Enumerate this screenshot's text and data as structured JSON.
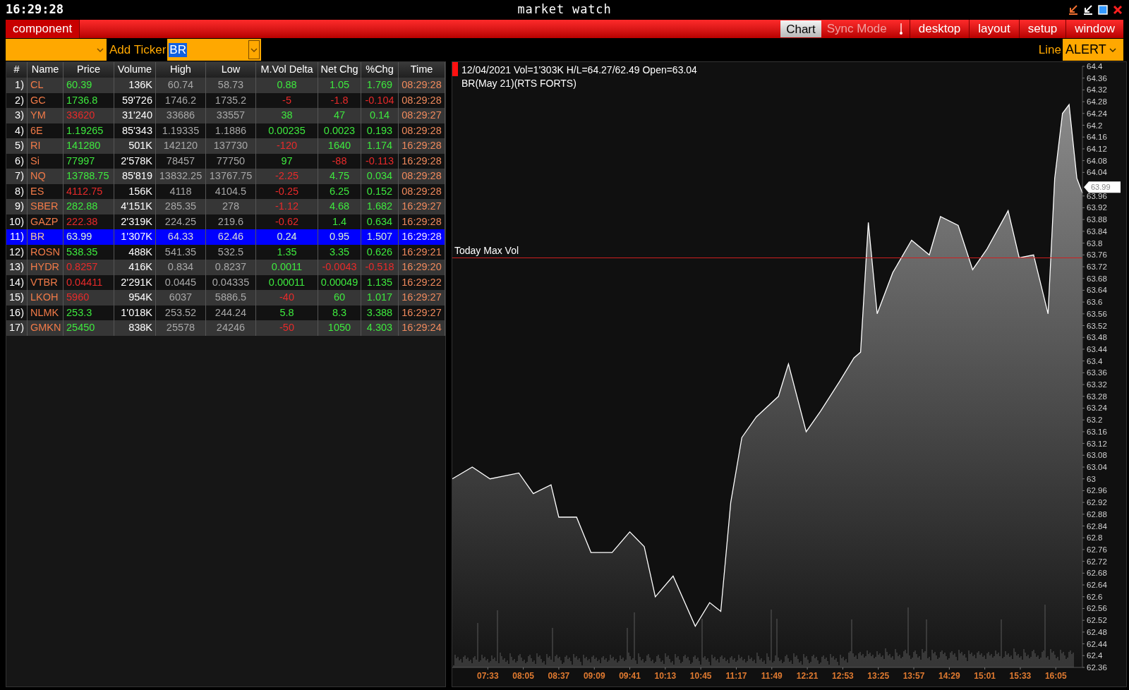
{
  "window": {
    "clock": "16:29:28",
    "title": "market watch"
  },
  "menu_bar": {
    "component": "component",
    "mode_buttons": [
      {
        "label": "Chart",
        "selected": true
      },
      {
        "label": "Sync Mode",
        "selected": false
      }
    ],
    "menus": [
      "desktop",
      "layout",
      "setup",
      "window"
    ]
  },
  "toolbar": {
    "add_ticker_label": "Add Ticker",
    "ticker_value": "BR",
    "line_label": "Line",
    "line_value": "ALERT"
  },
  "table": {
    "columns": [
      "#",
      "Name",
      "Price",
      "Volume",
      "High",
      "Low",
      "M.Vol Delta",
      "Net Chg",
      "%Chg",
      "Time"
    ],
    "rows": [
      {
        "num": "1)",
        "name": "CL",
        "price": {
          "text": "60.39",
          "up": true
        },
        "volume": "136K",
        "high": "60.74",
        "low": "58.73",
        "mvol_delta": {
          "text": "0.88",
          "up": true
        },
        "net_chg": {
          "text": "1.05",
          "up": true
        },
        "pct_chg": {
          "text": "1.769",
          "up": true
        },
        "time": "08:29:28",
        "selected": false
      },
      {
        "num": "2)",
        "name": "GC",
        "price": {
          "text": "1736.8",
          "up": true
        },
        "volume": "59'726",
        "high": "1746.2",
        "low": "1735.2",
        "mvol_delta": {
          "text": "-5",
          "up": false
        },
        "net_chg": {
          "text": "-1.8",
          "up": false
        },
        "pct_chg": {
          "text": "-0.104",
          "up": false
        },
        "time": "08:29:28",
        "selected": false
      },
      {
        "num": "3)",
        "name": "YM",
        "price": {
          "text": "33620",
          "up": false
        },
        "volume": "31'240",
        "high": "33686",
        "low": "33557",
        "mvol_delta": {
          "text": "38",
          "up": true
        },
        "net_chg": {
          "text": "47",
          "up": true
        },
        "pct_chg": {
          "text": "0.14",
          "up": true
        },
        "time": "08:29:27",
        "selected": false
      },
      {
        "num": "4)",
        "name": "6E",
        "price": {
          "text": "1.19265",
          "up": true
        },
        "volume": "85'343",
        "high": "1.19335",
        "low": "1.1886",
        "mvol_delta": {
          "text": "0.00235",
          "up": true
        },
        "net_chg": {
          "text": "0.0023",
          "up": true
        },
        "pct_chg": {
          "text": "0.193",
          "up": true
        },
        "time": "08:29:28",
        "selected": false
      },
      {
        "num": "5)",
        "name": "RI",
        "price": {
          "text": "141280",
          "up": true
        },
        "volume": "501K",
        "high": "142120",
        "low": "137730",
        "mvol_delta": {
          "text": "-120",
          "up": false
        },
        "net_chg": {
          "text": "1640",
          "up": true
        },
        "pct_chg": {
          "text": "1.174",
          "up": true
        },
        "time": "16:29:28",
        "selected": false
      },
      {
        "num": "6)",
        "name": "Si",
        "price": {
          "text": "77997",
          "up": true
        },
        "volume": "2'578K",
        "high": "78457",
        "low": "77750",
        "mvol_delta": {
          "text": "97",
          "up": true
        },
        "net_chg": {
          "text": "-88",
          "up": false
        },
        "pct_chg": {
          "text": "-0.113",
          "up": false
        },
        "time": "16:29:28",
        "selected": false
      },
      {
        "num": "7)",
        "name": "NQ",
        "price": {
          "text": "13788.75",
          "up": true
        },
        "volume": "85'819",
        "high": "13832.25",
        "low": "13767.75",
        "mvol_delta": {
          "text": "-2.25",
          "up": false
        },
        "net_chg": {
          "text": "4.75",
          "up": true
        },
        "pct_chg": {
          "text": "0.034",
          "up": true
        },
        "time": "08:29:28",
        "selected": false
      },
      {
        "num": "8)",
        "name": "ES",
        "price": {
          "text": "4112.75",
          "up": false
        },
        "volume": "156K",
        "high": "4118",
        "low": "4104.5",
        "mvol_delta": {
          "text": "-0.25",
          "up": false
        },
        "net_chg": {
          "text": "6.25",
          "up": true
        },
        "pct_chg": {
          "text": "0.152",
          "up": true
        },
        "time": "08:29:28",
        "selected": false
      },
      {
        "num": "9)",
        "name": "SBER",
        "price": {
          "text": "282.88",
          "up": true
        },
        "volume": "4'151K",
        "high": "285.35",
        "low": "278",
        "mvol_delta": {
          "text": "-1.12",
          "up": false
        },
        "net_chg": {
          "text": "4.68",
          "up": true
        },
        "pct_chg": {
          "text": "1.682",
          "up": true
        },
        "time": "16:29:27",
        "selected": false
      },
      {
        "num": "10)",
        "name": "GAZP",
        "price": {
          "text": "222.38",
          "up": false
        },
        "volume": "2'319K",
        "high": "224.25",
        "low": "219.6",
        "mvol_delta": {
          "text": "-0.62",
          "up": false
        },
        "net_chg": {
          "text": "1.4",
          "up": true
        },
        "pct_chg": {
          "text": "0.634",
          "up": true
        },
        "time": "16:29:28",
        "selected": false
      },
      {
        "num": "11)",
        "name": "BR",
        "price": {
          "text": "63.99",
          "up": true
        },
        "volume": "1'307K",
        "high": "64.33",
        "low": "62.46",
        "mvol_delta": {
          "text": "0.24",
          "up": true
        },
        "net_chg": {
          "text": "0.95",
          "up": true
        },
        "pct_chg": {
          "text": "1.507",
          "up": true
        },
        "time": "16:29:28",
        "selected": true
      },
      {
        "num": "12)",
        "name": "ROSN",
        "price": {
          "text": "538.35",
          "up": true
        },
        "volume": "488K",
        "high": "541.35",
        "low": "532.5",
        "mvol_delta": {
          "text": "1.35",
          "up": true
        },
        "net_chg": {
          "text": "3.35",
          "up": true
        },
        "pct_chg": {
          "text": "0.626",
          "up": true
        },
        "time": "16:29:21",
        "selected": false
      },
      {
        "num": "13)",
        "name": "HYDR",
        "price": {
          "text": "0.8257",
          "up": false
        },
        "volume": "416K",
        "high": "0.834",
        "low": "0.8237",
        "mvol_delta": {
          "text": "0.0011",
          "up": true
        },
        "net_chg": {
          "text": "-0.0043",
          "up": false
        },
        "pct_chg": {
          "text": "-0.518",
          "up": false
        },
        "time": "16:29:20",
        "selected": false
      },
      {
        "num": "14)",
        "name": "VTBR",
        "price": {
          "text": "0.04411",
          "up": false
        },
        "volume": "2'291K",
        "high": "0.0445",
        "low": "0.04335",
        "mvol_delta": {
          "text": "0.00011",
          "up": true
        },
        "net_chg": {
          "text": "0.00049",
          "up": true
        },
        "pct_chg": {
          "text": "1.135",
          "up": true
        },
        "time": "16:29:22",
        "selected": false
      },
      {
        "num": "15)",
        "name": "LKOH",
        "price": {
          "text": "5960",
          "up": false
        },
        "volume": "954K",
        "high": "6037",
        "low": "5886.5",
        "mvol_delta": {
          "text": "-40",
          "up": false
        },
        "net_chg": {
          "text": "60",
          "up": true
        },
        "pct_chg": {
          "text": "1.017",
          "up": true
        },
        "time": "16:29:27",
        "selected": false
      },
      {
        "num": "16)",
        "name": "NLMK",
        "price": {
          "text": "253.3",
          "up": true
        },
        "volume": "1'018K",
        "high": "253.52",
        "low": "244.24",
        "mvol_delta": {
          "text": "5.8",
          "up": true
        },
        "net_chg": {
          "text": "8.3",
          "up": true
        },
        "pct_chg": {
          "text": "3.388",
          "up": true
        },
        "time": "16:29:27",
        "selected": false
      },
      {
        "num": "17)",
        "name": "GMKN",
        "price": {
          "text": "25450",
          "up": true
        },
        "volume": "838K",
        "high": "25578",
        "low": "24246",
        "mvol_delta": {
          "text": "-50",
          "up": false
        },
        "net_chg": {
          "text": "1050",
          "up": true
        },
        "pct_chg": {
          "text": "4.303",
          "up": true
        },
        "time": "16:29:24",
        "selected": false
      }
    ]
  },
  "chart": {
    "info": "12/04/2021 Vol=1'303K H/L=64.27/62.49 Open=63.04",
    "instrument": "BR(May 21)(RTS FORTS)",
    "chart_data": {
      "type": "area",
      "x": [
        421,
        439,
        455,
        481,
        494,
        510,
        517,
        533,
        546,
        565,
        581,
        594,
        604,
        620,
        640,
        653,
        663,
        672,
        682,
        695,
        715,
        724,
        740,
        753,
        770,
        783,
        789,
        796,
        804,
        818,
        835,
        851,
        861,
        877,
        890,
        903,
        922,
        932,
        945,
        958,
        964,
        971,
        977,
        984,
        989
      ],
      "series": [
        {
          "color": "#ffffff",
          "values": [
            63.0,
            63.04,
            63.0,
            63.02,
            62.95,
            62.98,
            62.87,
            62.87,
            62.75,
            62.75,
            62.82,
            62.77,
            62.6,
            62.67,
            62.5,
            62.58,
            62.55,
            62.92,
            63.14,
            63.21,
            63.28,
            63.39,
            63.16,
            63.23,
            63.33,
            63.41,
            63.43,
            63.87,
            63.56,
            63.7,
            63.81,
            63.76,
            63.89,
            63.86,
            63.71,
            63.78,
            63.91,
            63.75,
            63.76,
            63.56,
            64.02,
            64.24,
            64.27,
            64.02,
            63.97
          ]
        }
      ],
      "xlim": [
        421,
        989
      ],
      "ylim": [
        62.36,
        64.4
      ],
      "xticks": [
        {
          "value": 453,
          "label": "07:33"
        },
        {
          "value": 485,
          "label": "08:05"
        },
        {
          "value": 517,
          "label": "08:37"
        },
        {
          "value": 549,
          "label": "09:09"
        },
        {
          "value": 581,
          "label": "09:41"
        },
        {
          "value": 613,
          "label": "10:13"
        },
        {
          "value": 645,
          "label": "10:45"
        },
        {
          "value": 677,
          "label": "11:17"
        },
        {
          "value": 709,
          "label": "11:49"
        },
        {
          "value": 741,
          "label": "12:21"
        },
        {
          "value": 773,
          "label": "12:53"
        },
        {
          "value": 805,
          "label": "13:25"
        },
        {
          "value": 837,
          "label": "13:57"
        },
        {
          "value": 869,
          "label": "14:29"
        },
        {
          "value": 901,
          "label": "15:01"
        },
        {
          "value": 933,
          "label": "15:33"
        },
        {
          "value": 965,
          "label": "16:05"
        }
      ],
      "yticks": [
        62.36,
        62.4,
        62.44,
        62.48,
        62.52,
        62.56,
        62.6,
        62.64,
        62.68,
        62.72,
        62.76,
        62.8,
        62.84,
        62.88,
        62.92,
        62.96,
        63,
        63.04,
        63.08,
        63.12,
        63.16,
        63.2,
        63.24,
        63.28,
        63.32,
        63.36,
        63.4,
        63.44,
        63.48,
        63.52,
        63.56,
        63.6,
        63.64,
        63.68,
        63.72,
        63.76,
        63.8,
        63.84,
        63.88,
        63.92,
        63.96,
        64.04,
        64.08,
        64.12,
        64.16,
        64.2,
        64.24,
        64.28,
        64.32,
        64.36,
        64.4
      ],
      "ref_lines": [
        {
          "axis": "y",
          "value": 63.75,
          "label": "Today Max Vol",
          "color": "#d02020"
        }
      ],
      "annotations": [
        {
          "text": "63.99",
          "x": 989,
          "y": 63.99
        }
      ]
    }
  }
}
